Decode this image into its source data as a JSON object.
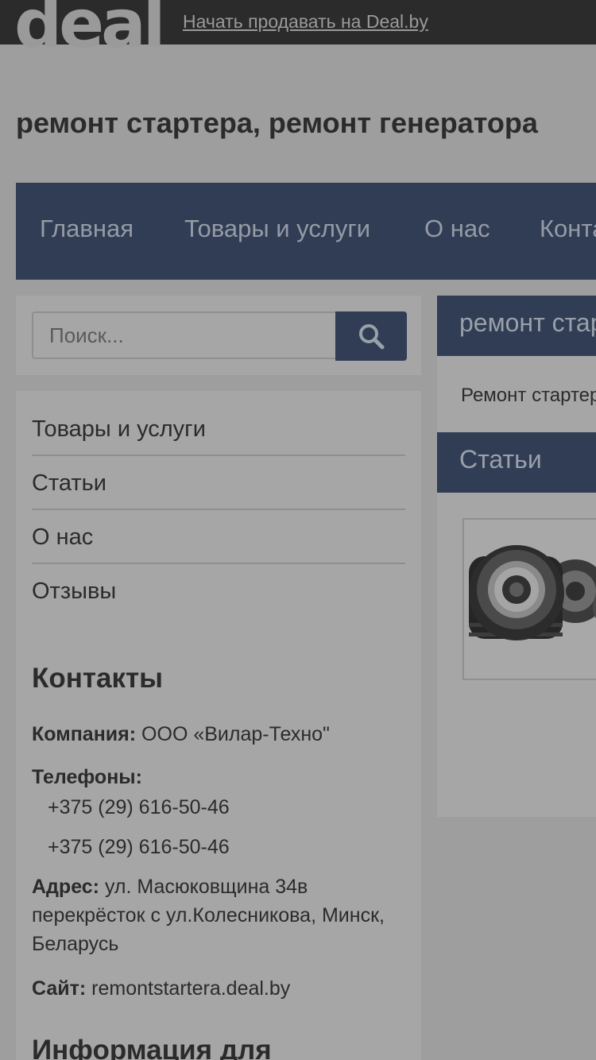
{
  "topbar": {
    "logo_text": "deal",
    "sell_link": "Начать продавать на Deal.by"
  },
  "site_title": "ремонт стартера, ремонт генератора",
  "main_nav": {
    "items": [
      {
        "label": "Главная"
      },
      {
        "label": "Товары и услуги"
      },
      {
        "label": "О нас"
      },
      {
        "label": "Контакты"
      }
    ]
  },
  "search": {
    "placeholder": "Поиск...",
    "icon": "search-icon"
  },
  "sidebar": {
    "menu": [
      {
        "label": "Товары и услуги"
      },
      {
        "label": "Статьи"
      },
      {
        "label": "О нас"
      },
      {
        "label": "Отзывы"
      }
    ],
    "contacts": {
      "title": "Контакты",
      "company_label": "Компания:",
      "company_value": "ООО «Вилар-Техно\"",
      "phones_label": "Телефоны:",
      "phones": [
        "+375 (29) 616-50-46",
        "+375 (29) 616-50-46"
      ],
      "address_label": "Адрес:",
      "address_value": "ул. Масюковщина 34в перекрёсток с ул.Колесникова, Минск, Беларусь",
      "site_label": "Сайт:",
      "site_value": "remontstartera.deal.by"
    },
    "info_title": "Информация для"
  },
  "content": {
    "panel1": {
      "title": "ремонт стартера, ремонт генератора",
      "text": "Ремонт стартеров и генераторов"
    },
    "panel2": {
      "title": "Статьи"
    }
  },
  "colors": {
    "accent": "#303d55",
    "topbar": "#2b2b2b",
    "overlay_background": "#9e9e9e"
  }
}
